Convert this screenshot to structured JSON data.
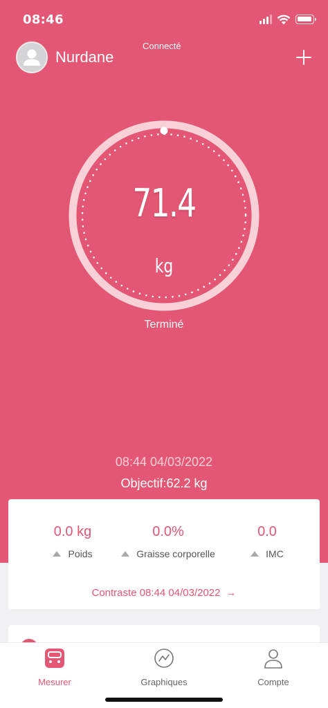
{
  "status_bar": {
    "time": "08:46"
  },
  "header": {
    "user_name": "Nurdane",
    "connection_status": "Connecté"
  },
  "measurement": {
    "value": "71.4",
    "unit": "kg",
    "state": "Terminé",
    "datetime": "08:44 04/03/2022",
    "goal": "Objectif:62.2 kg"
  },
  "summary": {
    "metrics": [
      {
        "value": "0.0 kg",
        "label": "Poids"
      },
      {
        "value": "0.0%",
        "label": "Graisse corporelle"
      },
      {
        "value": "0.0",
        "label": "IMC"
      }
    ],
    "compare": "Contraste 08:44 04/03/2022",
    "compare_arrow": "→"
  },
  "tabs": [
    {
      "label": "Mesurer",
      "icon": "scale-icon",
      "active": true
    },
    {
      "label": "Graphiques",
      "icon": "chart-icon",
      "active": false
    },
    {
      "label": "Compte",
      "icon": "person-icon",
      "active": false
    }
  ],
  "colors": {
    "brand": "#e35674",
    "background": "#f1f1f4",
    "card": "#ffffff"
  }
}
